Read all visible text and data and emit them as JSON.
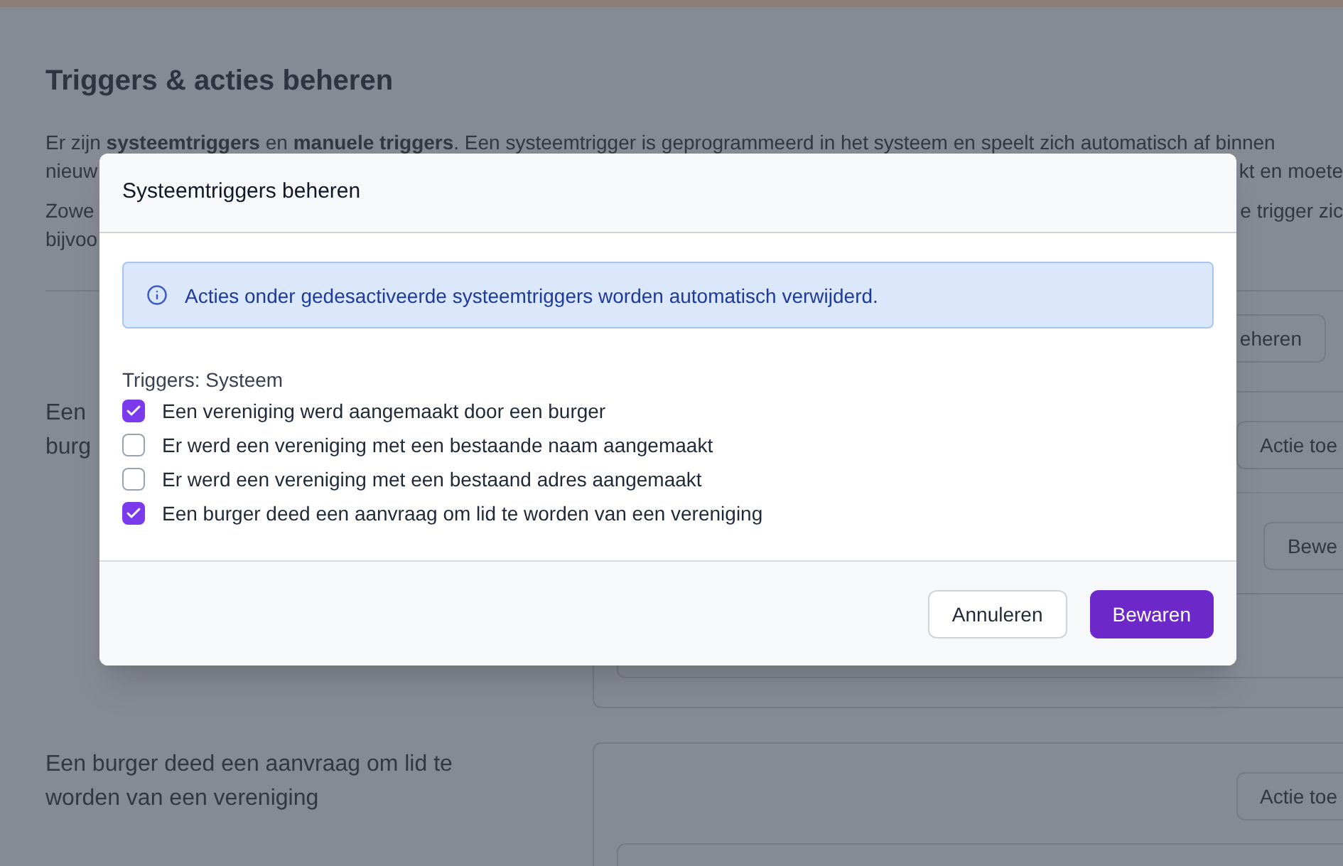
{
  "page": {
    "title": "Triggers & acties beheren",
    "intro_lines": [
      {
        "left": "Er zijn **systeemtriggers** en **manuele triggers**. Een systeemtrigger is geprogrammeerd in het systeem en speelt zich automatisch af binnen"
      },
      {
        "left": "nieuw",
        "right": "kt en moete"
      },
      {
        "left": "Zowe",
        "right": "e trigger zic"
      },
      {
        "left": "bijvoo"
      }
    ],
    "manage_button": "eheren",
    "trigger_rows": [
      {
        "label_lines": [
          "Een",
          "burg"
        ],
        "buttons": [
          "Actie toe",
          "Bewe"
        ]
      },
      {
        "label_lines": [
          "Een burger deed een aanvraag om lid te",
          "worden van een vereniging"
        ],
        "buttons": [
          "Actie toe"
        ]
      }
    ]
  },
  "dialog": {
    "title": "Systeemtriggers beheren",
    "alert": "Acties onder gedesactiveerde systeemtriggers worden automatisch verwijderd.",
    "group_label": "Triggers: Systeem",
    "triggers": [
      {
        "label": "Een vereniging werd aangemaakt door een burger",
        "checked": true
      },
      {
        "label": "Er werd een vereniging met een bestaande naam aangemaakt",
        "checked": false
      },
      {
        "label": "Er werd een vereniging met een bestaand adres aangemaakt",
        "checked": false
      },
      {
        "label": "Een burger deed een aanvraag om lid te worden van een vereniging",
        "checked": true
      }
    ],
    "cancel_button": "Annuleren",
    "save_button": "Bewaren"
  }
}
